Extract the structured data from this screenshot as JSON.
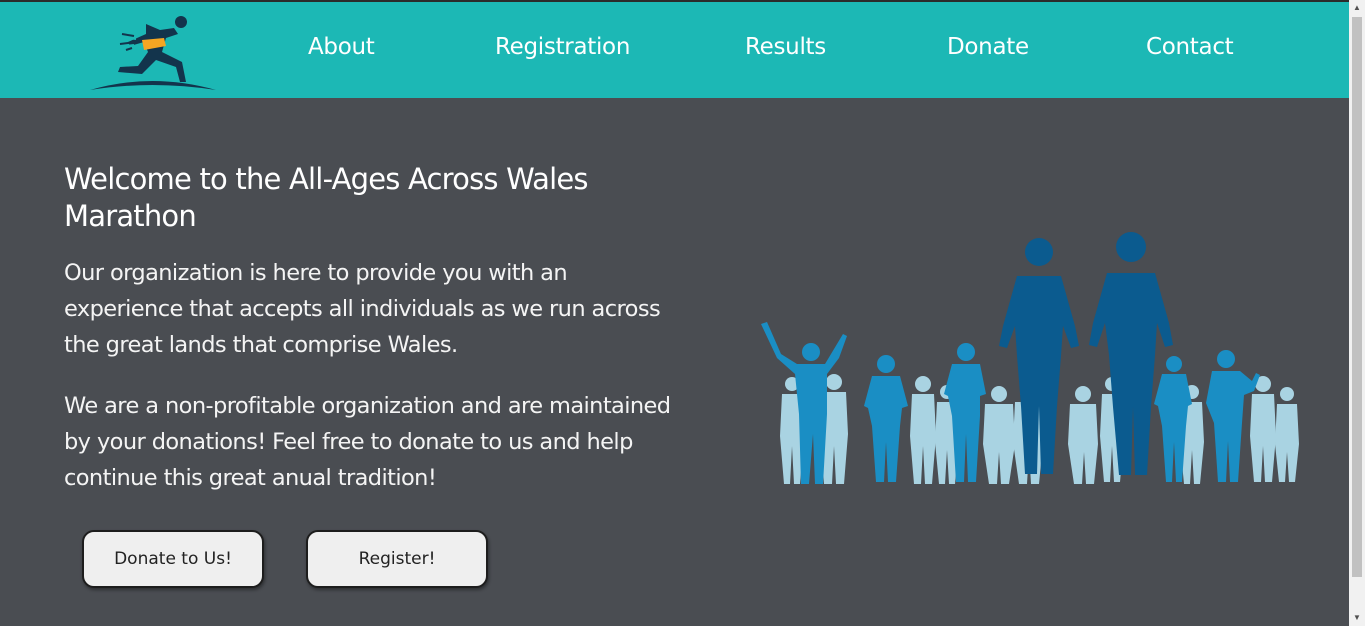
{
  "nav": {
    "logo_icon": "sprinter-logo-icon",
    "items": [
      {
        "label": "About"
      },
      {
        "label": "Registration"
      },
      {
        "label": "Results"
      },
      {
        "label": "Donate"
      },
      {
        "label": "Contact"
      }
    ]
  },
  "hero": {
    "title": "Welcome to the All-Ages Across Wales Marathon",
    "paragraph1": "Our organization is here to provide you with an experience that accepts all individuals as we run across the great lands that comprise Wales.",
    "paragraph2": "We are a non-profitable organization and are maintained by your donations! Feel free to donate to us and help continue this great anual tradition!",
    "donate_button": "Donate to Us!",
    "register_button": "Register!",
    "illustration_icon": "marathon-runners-illustration"
  },
  "colors": {
    "navbar": "#1cb8b5",
    "background": "#4a4d52",
    "runner_dark": "#0b5b8f",
    "runner_mid": "#1a8ec4",
    "runner_light": "#a9d3e2"
  }
}
